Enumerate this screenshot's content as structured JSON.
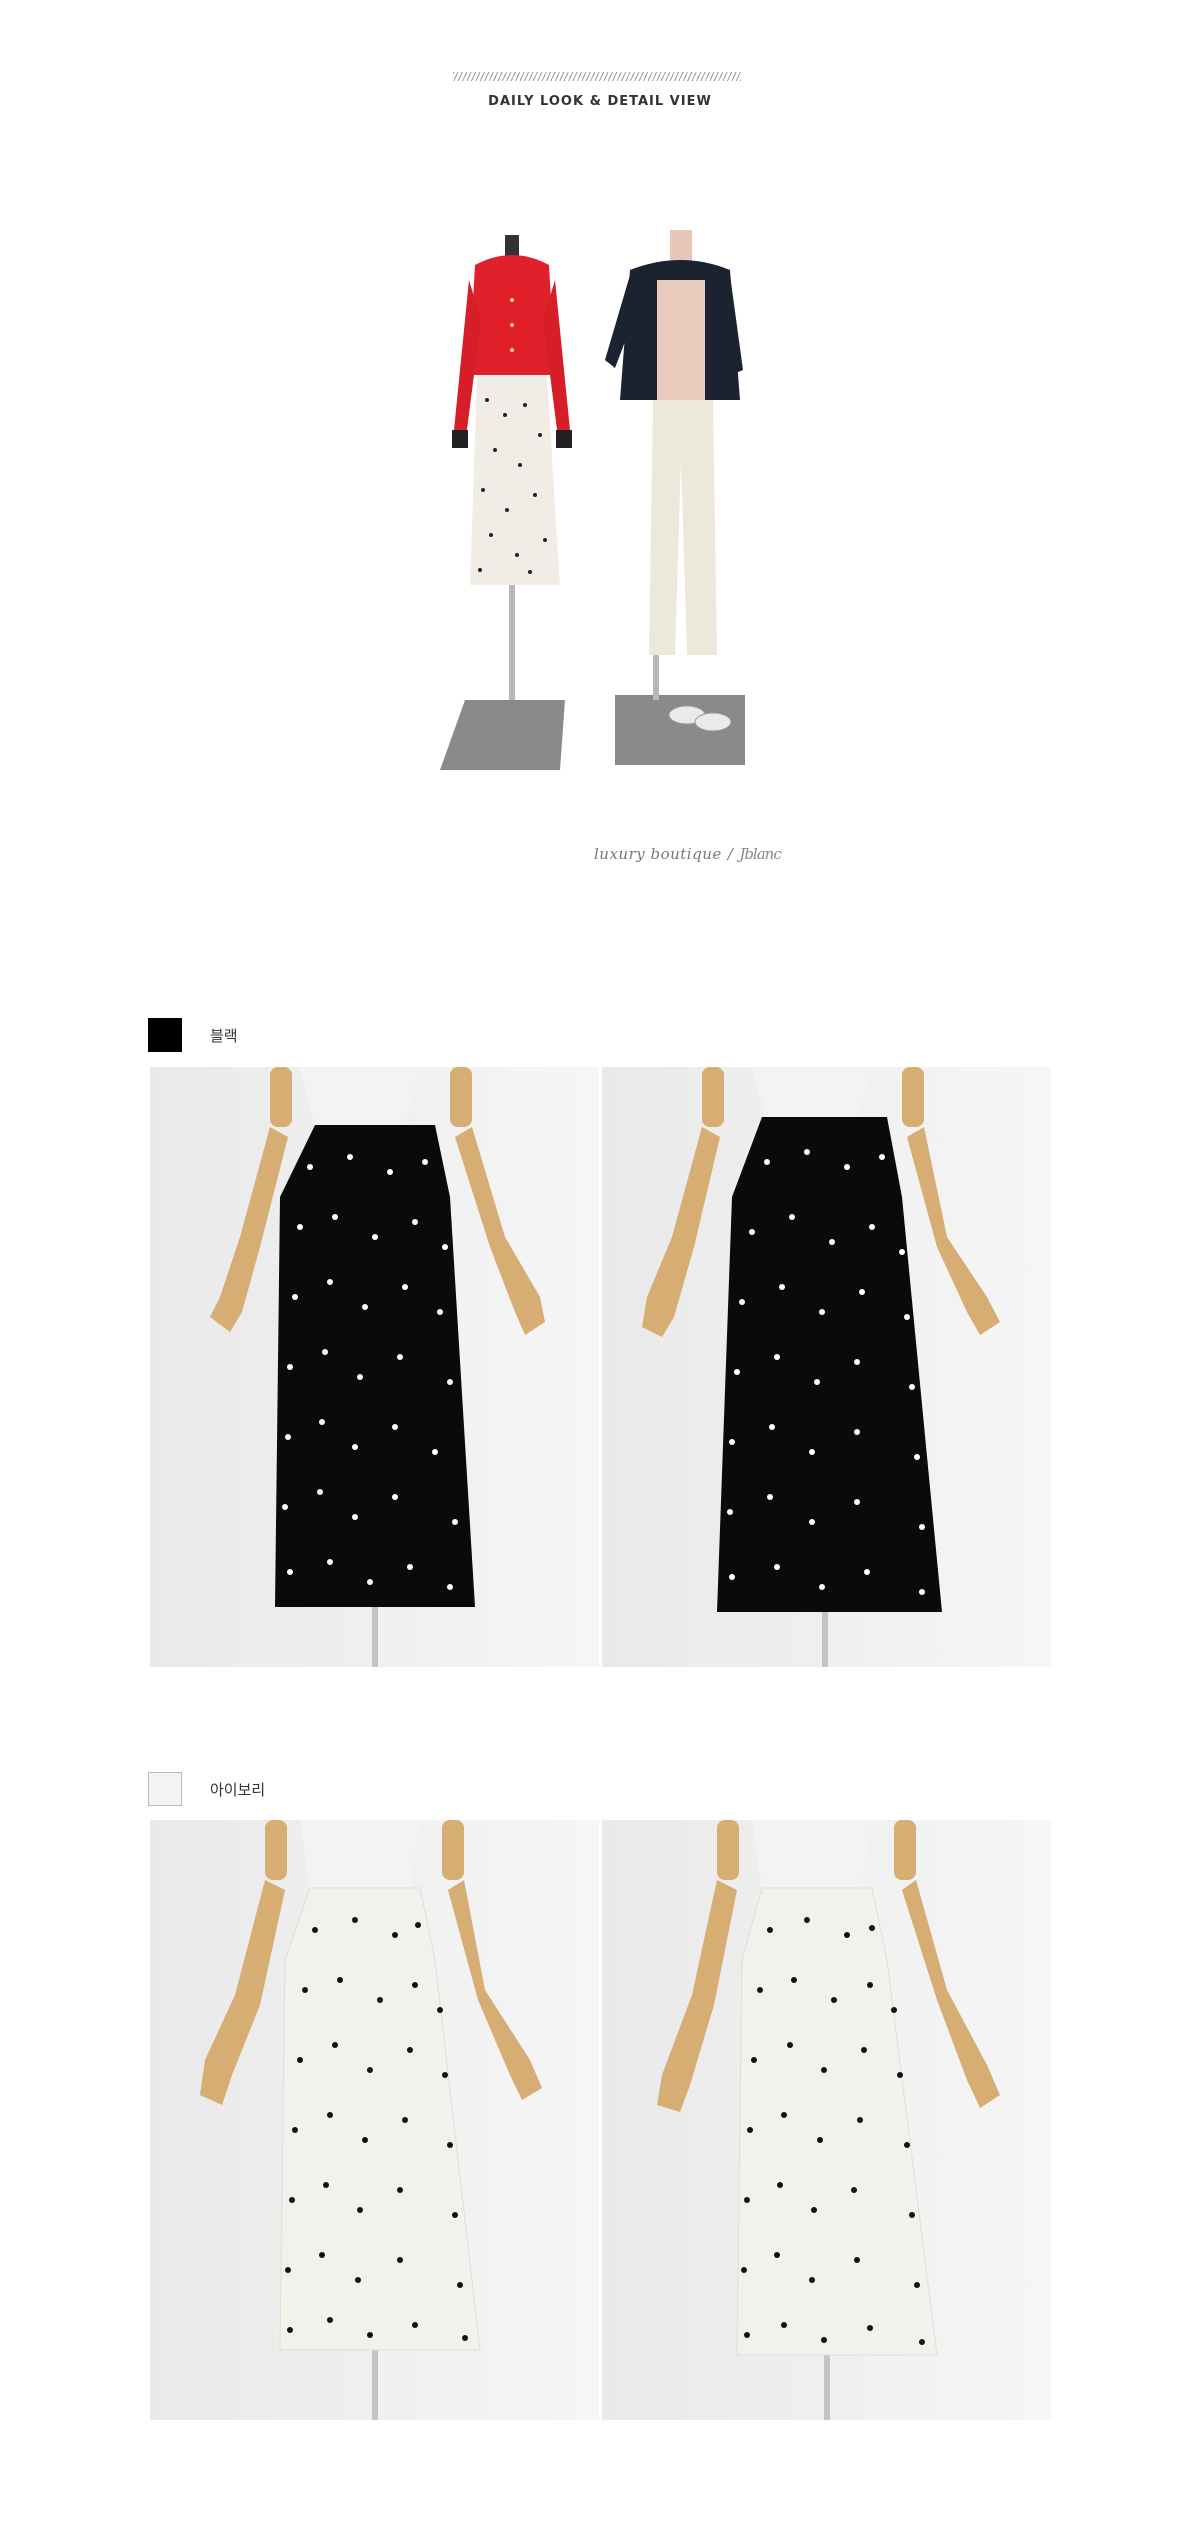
{
  "header": {
    "section_title": "DAILY LOOK & DETAIL VIEW"
  },
  "daily_look": {
    "caption_text": "luxury boutique",
    "caption_separator": "/",
    "signature": "Jblanc"
  },
  "colors": [
    {
      "label": "블랙",
      "swatch_color": "#000000",
      "skirt_color": "#0a0a0a",
      "dot_color": "#ffffff"
    },
    {
      "label": "아이보리",
      "swatch_color": "#f4f4f2",
      "skirt_color": "#f3f1ec",
      "dot_color": "#111111"
    }
  ]
}
